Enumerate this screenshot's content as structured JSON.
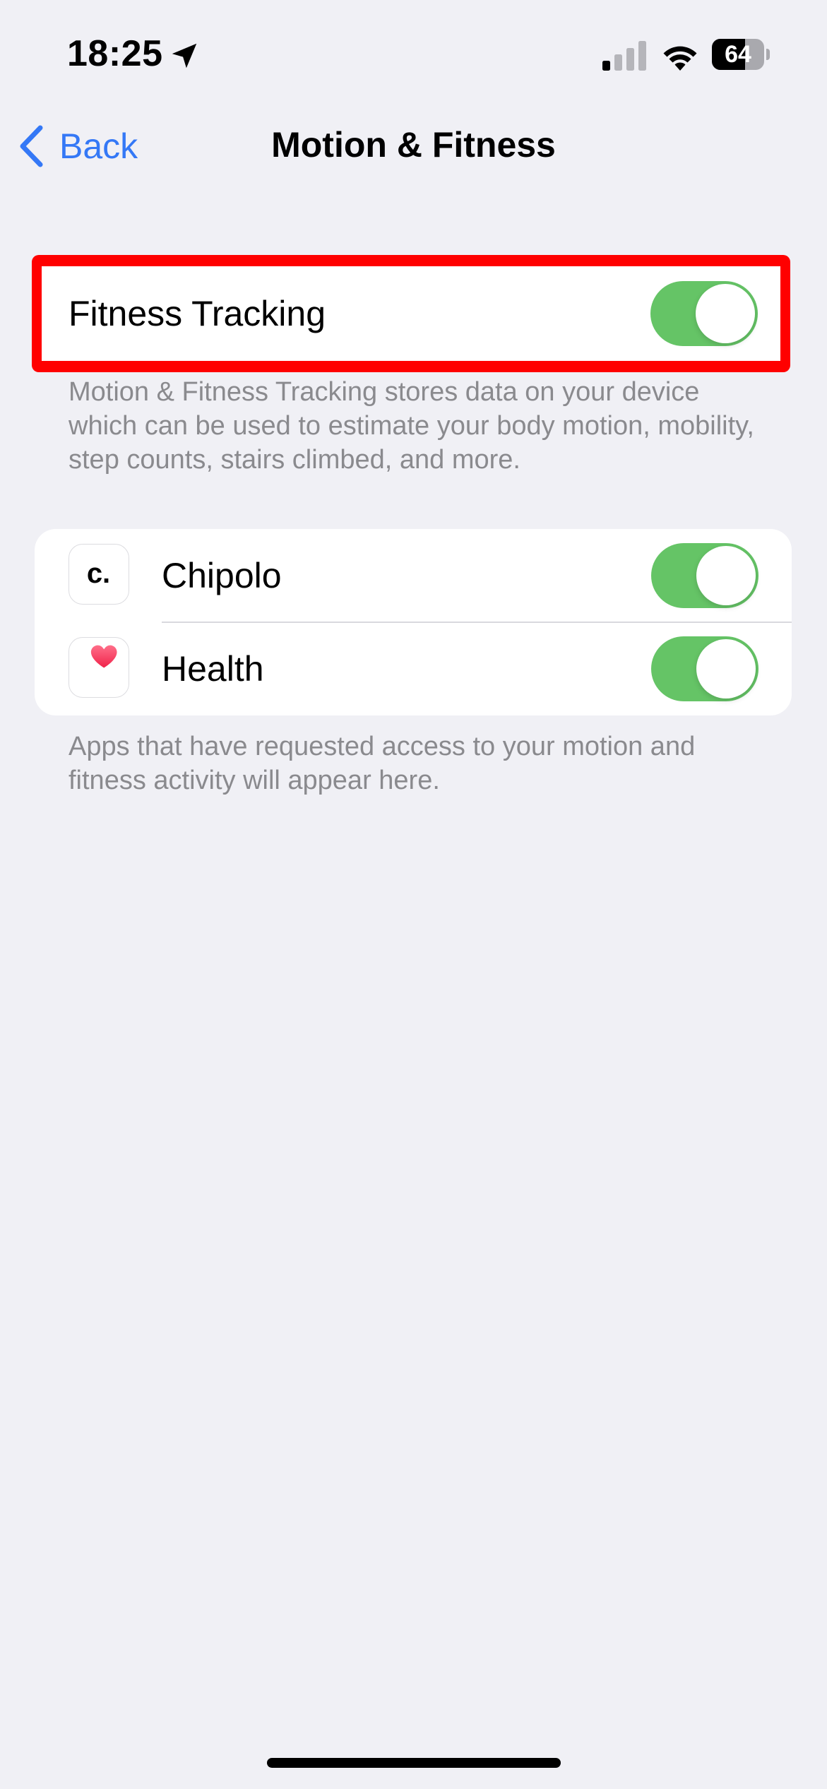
{
  "status_bar": {
    "time": "18:25",
    "battery_level": "64",
    "battery_fraction": 0.64,
    "signal_bars_active": 1,
    "signal_bars_total": 4,
    "icons": [
      "location-arrow-icon",
      "cellular-signal-icon",
      "wifi-icon",
      "battery-icon"
    ]
  },
  "nav": {
    "back_label": "Back",
    "title": "Motion & Fitness",
    "back_icon": "chevron-left-icon"
  },
  "fitness_tracking": {
    "label": "Fitness Tracking",
    "enabled": true,
    "footer": "Motion & Fitness Tracking stores data on your device which can be used to estimate your body motion, mobility, step counts, stairs climbed, and more."
  },
  "apps": {
    "items": [
      {
        "label": "Chipolo",
        "icon": "chipolo-icon",
        "icon_glyph": "c.",
        "enabled": true
      },
      {
        "label": "Health",
        "icon": "heart-icon",
        "enabled": true
      }
    ],
    "footer": "Apps that have requested access to your motion and fitness activity will appear here."
  },
  "colors": {
    "accent": "#3478F6",
    "toggle_on": "#65C466",
    "highlight": "#FF0000",
    "background": "#F0F0F5",
    "secondary_text": "#8A8A8E",
    "heart": "#FF3B5C"
  }
}
